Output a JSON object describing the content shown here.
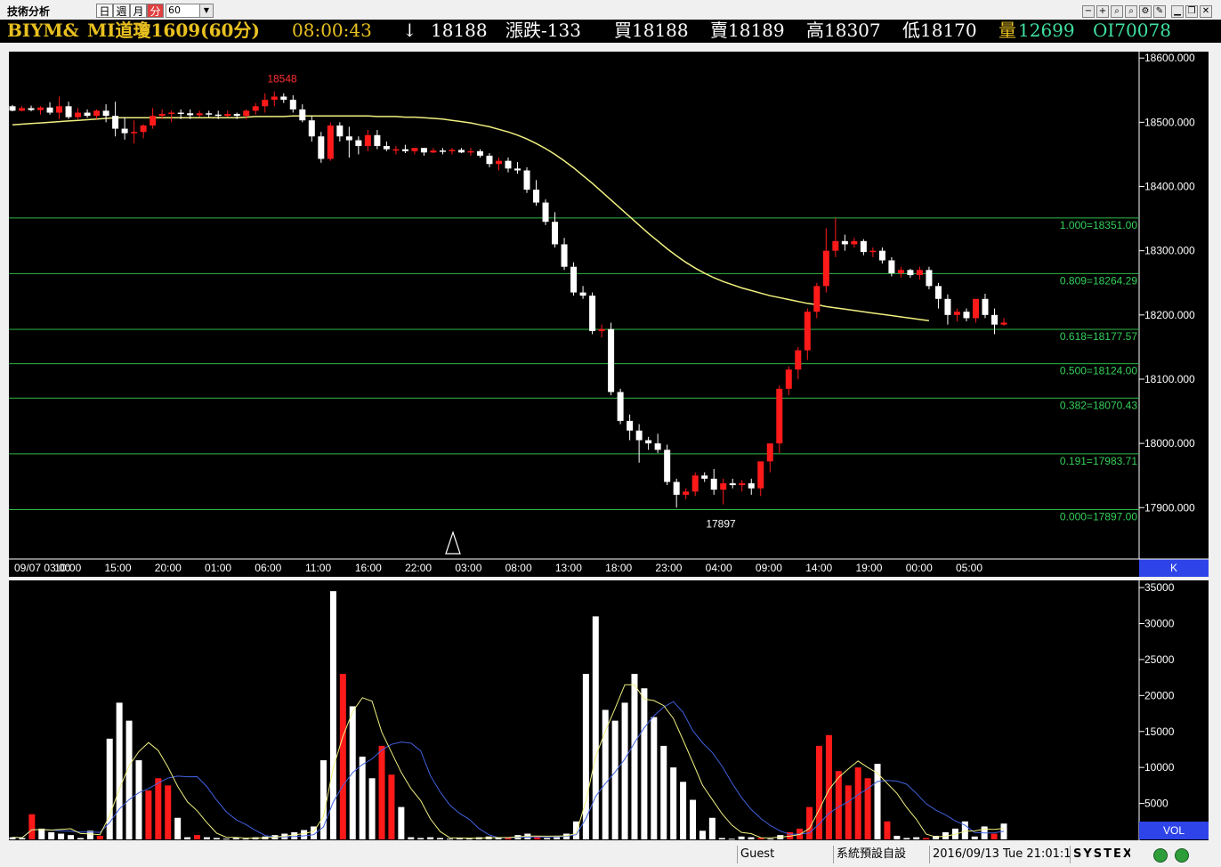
{
  "toolbar": {
    "app_title": "技術分析",
    "periods": [
      "日",
      "週",
      "月",
      "分"
    ],
    "active_period": "分",
    "interval": "60"
  },
  "quote": {
    "symbol": "BIYM&",
    "name": "MI道瓊1609(60分)",
    "time": "08:00:43",
    "direction": "↓",
    "last": "18188",
    "change": "漲跌-133",
    "bid": "買18188",
    "ask": "賣18189",
    "high": "高18307",
    "low": "低18170",
    "volume_label": "量",
    "volume": "12699",
    "oi": "OI70078",
    "colors": {
      "gold": "#e8c020",
      "white": "#ffffff",
      "green": "#40e0a0"
    }
  },
  "chart_data": {
    "type": "candlestick",
    "y_axis": {
      "min": 17820,
      "max": 18610,
      "ticks": [
        "18600.000",
        "18500.000",
        "18400.000",
        "18300.000",
        "18200.000",
        "18100.000",
        "18000.000",
        "17900.000"
      ],
      "tick_values": [
        18600,
        18500,
        18400,
        18300,
        18200,
        18100,
        18000,
        17900
      ]
    },
    "x_labels": [
      "09/07 03:00",
      "10:00",
      "15:00",
      "20:00",
      "01:00",
      "06:00",
      "11:00",
      "16:00",
      "22:00",
      "03:00",
      "08:00",
      "13:00",
      "18:00",
      "23:00",
      "04:00",
      "09:00",
      "14:00",
      "19:00",
      "00:00",
      "05:00"
    ],
    "panel_label": "K",
    "annotations": {
      "high_label": "18548",
      "high_value": 18548,
      "low_label": "17897",
      "low_value": 17897
    },
    "fibonacci": [
      {
        "label": "1.000=18351.00",
        "value": 18351.0
      },
      {
        "label": "0.809=18264.29",
        "value": 18264.29
      },
      {
        "label": "0.618=18177.57",
        "value": 18177.57
      },
      {
        "label": "0.500=18124.00",
        "value": 18124.0
      },
      {
        "label": "0.382=18070.43",
        "value": 18070.43
      },
      {
        "label": "0.191=17983.71",
        "value": 17983.71
      },
      {
        "label": "0.000=17897.00",
        "value": 17897.0
      }
    ],
    "candles": [
      [
        18525,
        18527,
        18517,
        18518
      ],
      [
        18518,
        18525,
        18517,
        18522
      ],
      [
        18522,
        18526,
        18517,
        18519
      ],
      [
        18519,
        18525,
        18512,
        18523
      ],
      [
        18523,
        18531,
        18512,
        18515
      ],
      [
        18515,
        18540,
        18505,
        18525
      ],
      [
        18525,
        18532,
        18505,
        18508
      ],
      [
        18508,
        18522,
        18505,
        18515
      ],
      [
        18515,
        18520,
        18507,
        18510
      ],
      [
        18510,
        18520,
        18505,
        18518
      ],
      [
        18518,
        18528,
        18500,
        18510
      ],
      [
        18510,
        18532,
        18478,
        18490
      ],
      [
        18490,
        18508,
        18473,
        18483
      ],
      [
        18483,
        18503,
        18467,
        18485
      ],
      [
        18485,
        18497,
        18475,
        18495
      ],
      [
        18495,
        18522,
        18490,
        18510
      ],
      [
        18510,
        18520,
        18505,
        18513
      ],
      [
        18513,
        18518,
        18500,
        18515
      ],
      [
        18515,
        18520,
        18505,
        18514
      ],
      [
        18514,
        18520,
        18505,
        18511
      ],
      [
        18511,
        18518,
        18508,
        18514
      ],
      [
        18514,
        18518,
        18508,
        18512
      ],
      [
        18512,
        18518,
        18505,
        18510
      ],
      [
        18510,
        18518,
        18508,
        18513
      ],
      [
        18513,
        18515,
        18505,
        18510
      ],
      [
        18510,
        18520,
        18505,
        18518
      ],
      [
        18518,
        18530,
        18512,
        18525
      ],
      [
        18525,
        18545,
        18515,
        18535
      ],
      [
        18535,
        18548,
        18525,
        18540
      ],
      [
        18540,
        18545,
        18530,
        18535
      ],
      [
        18535,
        18542,
        18515,
        18520
      ],
      [
        18520,
        18528,
        18500,
        18503
      ],
      [
        18503,
        18510,
        18470,
        18478
      ],
      [
        18478,
        18485,
        18437,
        18443
      ],
      [
        18443,
        18500,
        18440,
        18495
      ],
      [
        18495,
        18500,
        18470,
        18478
      ],
      [
        18478,
        18493,
        18445,
        18472
      ],
      [
        18472,
        18478,
        18450,
        18463
      ],
      [
        18463,
        18488,
        18455,
        18480
      ],
      [
        18480,
        18488,
        18458,
        18463
      ],
      [
        18463,
        18470,
        18455,
        18458
      ],
      [
        18458,
        18463,
        18450,
        18458
      ],
      [
        18458,
        18465,
        18452,
        18455
      ],
      [
        18455,
        18460,
        18450,
        18460
      ],
      [
        18460,
        18460,
        18448,
        18453
      ],
      [
        18453,
        18460,
        18452,
        18456
      ],
      [
        18456,
        18460,
        18450,
        18455
      ],
      [
        18455,
        18460,
        18450,
        18457
      ],
      [
        18457,
        18460,
        18452,
        18453
      ],
      [
        18453,
        18460,
        18448,
        18455
      ],
      [
        18455,
        18458,
        18445,
        18448
      ],
      [
        18448,
        18452,
        18430,
        18435
      ],
      [
        18435,
        18445,
        18425,
        18440
      ],
      [
        18440,
        18445,
        18422,
        18428
      ],
      [
        18428,
        18438,
        18420,
        18425
      ],
      [
        18425,
        18430,
        18390,
        18395
      ],
      [
        18395,
        18410,
        18370,
        18375
      ],
      [
        18375,
        18380,
        18340,
        18345
      ],
      [
        18345,
        18360,
        18305,
        18310
      ],
      [
        18310,
        18320,
        18270,
        18275
      ],
      [
        18275,
        18282,
        18230,
        18235
      ],
      [
        18235,
        18245,
        18225,
        18230
      ],
      [
        18230,
        18235,
        18170,
        18175
      ],
      [
        18175,
        18185,
        18165,
        18178
      ],
      [
        18178,
        18188,
        18075,
        18080
      ],
      [
        18080,
        18085,
        18030,
        18035
      ],
      [
        18035,
        18045,
        18005,
        18020
      ],
      [
        18020,
        18030,
        17970,
        18005
      ],
      [
        18005,
        18010,
        17990,
        18000
      ],
      [
        18000,
        18015,
        17985,
        17990
      ],
      [
        17990,
        17998,
        17935,
        17940
      ],
      [
        17940,
        17945,
        17900,
        17920
      ],
      [
        17920,
        17930,
        17913,
        17925
      ],
      [
        17925,
        17955,
        17918,
        17950
      ],
      [
        17950,
        17955,
        17940,
        17945
      ],
      [
        17945,
        17960,
        17920,
        17928
      ],
      [
        17928,
        17945,
        17905,
        17938
      ],
      [
        17938,
        17945,
        17930,
        17935
      ],
      [
        17935,
        17943,
        17925,
        17938
      ],
      [
        17938,
        17945,
        17920,
        17930
      ],
      [
        17930,
        17970,
        17918,
        17972
      ],
      [
        17972,
        17990,
        17955,
        18000
      ],
      [
        18000,
        18090,
        17985,
        18085
      ],
      [
        18085,
        18120,
        18075,
        18115
      ],
      [
        18115,
        18150,
        18100,
        18145
      ],
      [
        18145,
        18210,
        18130,
        18205
      ],
      [
        18205,
        18250,
        18195,
        18245
      ],
      [
        18245,
        18335,
        18235,
        18300
      ],
      [
        18300,
        18351,
        18290,
        18315
      ],
      [
        18315,
        18325,
        18300,
        18310
      ],
      [
        18310,
        18320,
        18305,
        18315
      ],
      [
        18315,
        18318,
        18293,
        18298
      ],
      [
        18298,
        18305,
        18290,
        18300
      ],
      [
        18300,
        18305,
        18280,
        18285
      ],
      [
        18285,
        18290,
        18260,
        18265
      ],
      [
        18265,
        18275,
        18258,
        18270
      ],
      [
        18270,
        18272,
        18258,
        18262
      ],
      [
        18262,
        18275,
        18255,
        18270
      ],
      [
        18270,
        18275,
        18240,
        18245
      ],
      [
        18245,
        18250,
        18210,
        18225
      ],
      [
        18225,
        18232,
        18185,
        18200
      ],
      [
        18200,
        18210,
        18190,
        18205
      ],
      [
        18205,
        18210,
        18190,
        18195
      ],
      [
        18195,
        18220,
        18188,
        18225
      ],
      [
        18225,
        18233,
        18195,
        18200
      ],
      [
        18200,
        18210,
        18170,
        18185
      ],
      [
        18185,
        18195,
        18183,
        18188
      ]
    ],
    "ma": {
      "color": "#f0f080",
      "values": [
        18496,
        18497,
        18498,
        18499,
        18500,
        18501,
        18502,
        18503,
        18504,
        18505,
        18506,
        18507,
        18507,
        18507,
        18507,
        18507,
        18507,
        18507,
        18507,
        18507,
        18507,
        18507,
        18507,
        18507,
        18507,
        18508,
        18509,
        18509,
        18509,
        18509,
        18510,
        18510,
        18510,
        18510,
        18510,
        18510,
        18510,
        18510,
        18510,
        18509,
        18509,
        18509,
        18508,
        18508,
        18507,
        18506,
        18505,
        18503,
        18501,
        18499,
        18496,
        18493,
        18489,
        18485,
        18480,
        18474,
        18467,
        18459,
        18450,
        18440,
        18429,
        18417,
        18405,
        18392,
        18379,
        18366,
        18353,
        18340,
        18327,
        18315,
        18303,
        18292,
        18282,
        18273,
        18265,
        18258,
        18252,
        18247,
        18242,
        18238,
        18234,
        18230,
        18227,
        18224,
        18221,
        18218,
        18216,
        18213,
        18211,
        18209,
        18207,
        18205,
        18203,
        18201,
        18199,
        18197,
        18195,
        18193,
        18191
      ]
    },
    "volume_panel": {
      "label": "VOL",
      "y_ticks": [
        "35000",
        "30000",
        "25000",
        "20000",
        "15000",
        "10000",
        "5000"
      ],
      "y_tick_values": [
        35000,
        30000,
        25000,
        20000,
        15000,
        10000,
        5000
      ],
      "y_max": 36000,
      "values": [
        300,
        200,
        3500,
        1500,
        1000,
        800,
        600,
        200,
        1200,
        500,
        14000,
        19000,
        16500,
        11000,
        6800,
        8500,
        7500,
        3000,
        300,
        600,
        300,
        200,
        100,
        200,
        100,
        300,
        400,
        600,
        800,
        1000,
        1300,
        1800,
        11000,
        34500,
        23000,
        18500,
        11500,
        8500,
        13000,
        9000,
        4500,
        300,
        200,
        300,
        200,
        100,
        200,
        100,
        300,
        400,
        300,
        200,
        600,
        800,
        400,
        200,
        300,
        800,
        2500,
        23000,
        31000,
        18000,
        16500,
        19000,
        23000,
        21000,
        17000,
        13000,
        10000,
        8000,
        5500,
        1200,
        3000,
        200,
        100,
        400,
        300,
        200,
        100,
        600,
        1000,
        1500,
        4500,
        13000,
        14500,
        9500,
        7500,
        10000,
        8500,
        10500,
        2500,
        500,
        200,
        300,
        200,
        500,
        1000,
        1500,
        2500,
        400,
        1800,
        800,
        2200
      ],
      "colors": [
        1,
        1,
        0,
        1,
        1,
        1,
        1,
        1,
        1,
        0,
        1,
        1,
        1,
        1,
        0,
        0,
        0,
        1,
        1,
        0,
        1,
        1,
        1,
        1,
        1,
        1,
        1,
        1,
        1,
        1,
        1,
        1,
        1,
        1,
        0,
        1,
        1,
        1,
        0,
        0,
        1,
        1,
        1,
        1,
        1,
        1,
        1,
        1,
        1,
        1,
        1,
        0,
        1,
        1,
        0,
        1,
        1,
        1,
        1,
        1,
        1,
        1,
        1,
        1,
        1,
        1,
        1,
        1,
        1,
        1,
        1,
        1,
        1,
        1,
        1,
        1,
        1,
        0,
        1,
        1,
        0,
        0,
        0,
        0,
        0,
        0,
        0,
        0,
        0,
        1,
        0,
        1,
        1,
        1,
        0,
        1,
        1,
        1,
        1,
        1,
        1,
        0,
        1,
        1,
        1
      ],
      "ma_fast_color": "#f0f080",
      "ma_slow_color": "#4060e0"
    }
  },
  "status": {
    "user": "Guest",
    "layout": "系統預設自設",
    "datetime": "2016/09/13 Tue 21:01:1",
    "brand": "SYSTEX"
  }
}
